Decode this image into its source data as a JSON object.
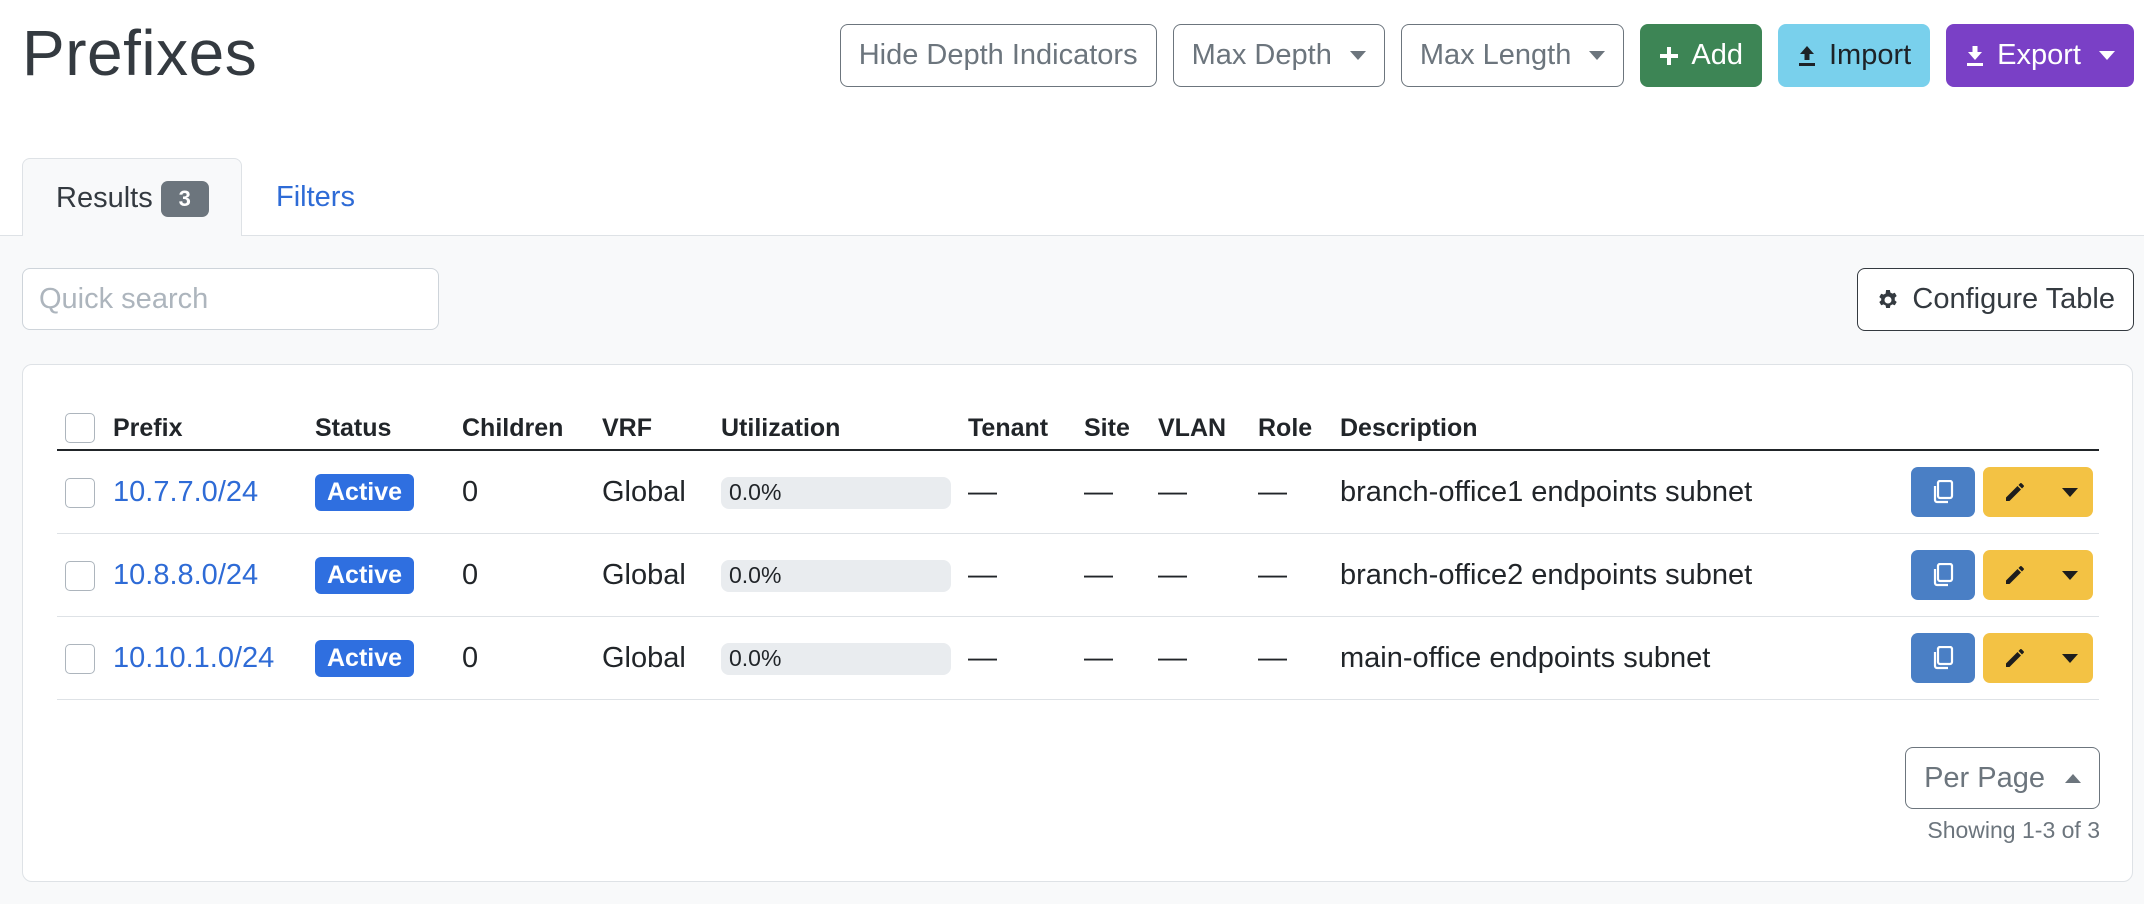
{
  "page": {
    "title": "Prefixes"
  },
  "header_actions": {
    "hide_depth": "Hide Depth Indicators",
    "max_depth": "Max Depth",
    "max_length": "Max Length",
    "add": "Add",
    "import": "Import",
    "export": "Export"
  },
  "tabs": {
    "results_label": "Results",
    "results_count": "3",
    "filters_label": "Filters"
  },
  "search": {
    "placeholder": "Quick search",
    "value": ""
  },
  "configure_table": "Configure Table",
  "table": {
    "columns": [
      "Prefix",
      "Status",
      "Children",
      "VRF",
      "Utilization",
      "Tenant",
      "Site",
      "VLAN",
      "Role",
      "Description"
    ],
    "rows": [
      {
        "prefix": "10.7.7.0/24",
        "status": "Active",
        "children": "0",
        "vrf": "Global",
        "utilization": "0.0%",
        "utilization_fraction": 0.0,
        "tenant": "—",
        "site": "—",
        "vlan": "—",
        "role": "—",
        "description": "branch-office1 endpoints subnet"
      },
      {
        "prefix": "10.8.8.0/24",
        "status": "Active",
        "children": "0",
        "vrf": "Global",
        "utilization": "0.0%",
        "utilization_fraction": 0.0,
        "tenant": "—",
        "site": "—",
        "vlan": "—",
        "role": "—",
        "description": "branch-office2 endpoints subnet"
      },
      {
        "prefix": "10.10.1.0/24",
        "status": "Active",
        "children": "0",
        "vrf": "Global",
        "utilization": "0.0%",
        "utilization_fraction": 0.0,
        "tenant": "—",
        "site": "—",
        "vlan": "—",
        "role": "—",
        "description": "main-office endpoints subnet"
      }
    ]
  },
  "pagination": {
    "per_page": "Per Page",
    "showing": "Showing 1-3 of 3"
  },
  "icons": {
    "add": "plus-icon",
    "import": "upload-icon",
    "export": "download-icon",
    "configure": "gear-icon",
    "copy": "copy-icon",
    "edit": "pencil-icon",
    "dropdown": "chevron-down-icon"
  },
  "colors": {
    "link": "#2e6bd6",
    "status_active": "#2f6fe0",
    "add": "#3d8555",
    "import": "#79d0ec",
    "export": "#7a40c6",
    "copy": "#4a7fc5",
    "edit": "#f3c244"
  }
}
